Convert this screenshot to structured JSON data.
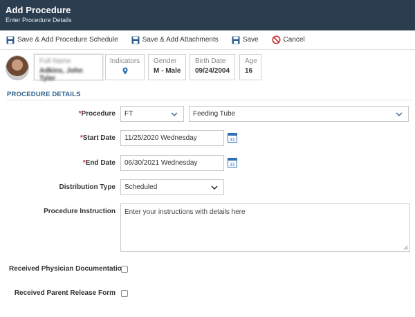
{
  "header": {
    "title": "Add Procedure",
    "subtitle": "Enter Procedure Details"
  },
  "toolbar": {
    "save_schedule": "Save & Add Procedure Schedule",
    "save_attachments": "Save & Add Attachments",
    "save": "Save",
    "cancel": "Cancel"
  },
  "patient": {
    "name_label": "Full Name",
    "name_value": "Adkins, John Tyler",
    "indicators_label": "Indicators",
    "gender_label": "Gender",
    "gender_value": "M - Male",
    "birth_label": "Birth Date",
    "birth_value": "09/24/2004",
    "age_label": "Age",
    "age_value": "16"
  },
  "section": {
    "title": "PROCEDURE DETAILS"
  },
  "form": {
    "required_mark": "*",
    "procedure_label": "Procedure",
    "procedure_code": "FT",
    "procedure_name": "Feeding Tube",
    "start_label": "Start Date",
    "start_value": "11/25/2020 Wednesday",
    "end_label": "End Date",
    "end_value": "06/30/2021 Wednesday",
    "distribution_label": "Distribution Type",
    "distribution_value": "Scheduled",
    "instruction_label": "Procedure Instruction",
    "instruction_placeholder": "Enter your instructions with details here",
    "physician_doc_label": "Received Physician Documentation",
    "parent_release_label": "Received Parent Release Form",
    "calendar_day": "31"
  },
  "colors": {
    "header_bg": "#2b3e50",
    "accent_blue": "#2f5f8c",
    "cancel_red": "#c62828"
  },
  "icons": [
    "floppy-disk-icon",
    "no-entry-icon",
    "map-pin-icon",
    "calendar-icon",
    "chevron-down-icon"
  ]
}
